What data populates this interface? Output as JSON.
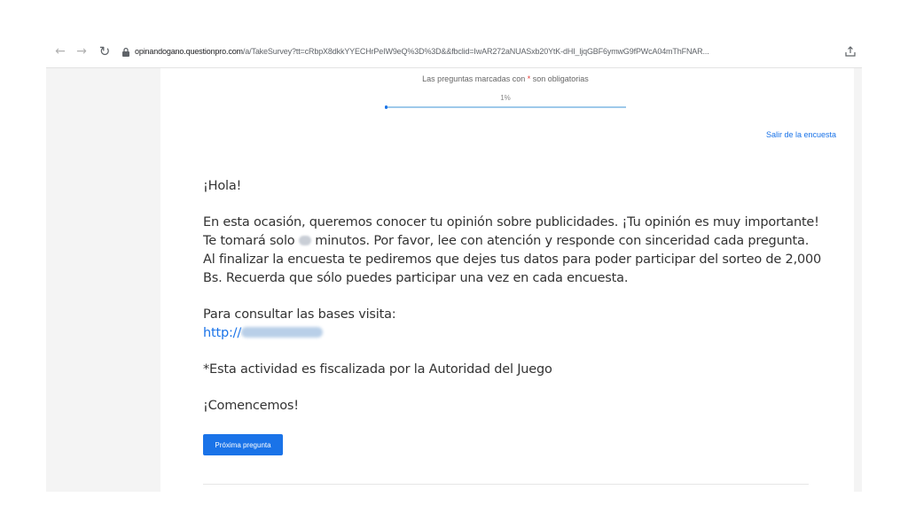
{
  "browser": {
    "url_host": "opinandogano.questionpro.com",
    "url_path": "/a/TakeSurvey?tt=cRbpX8dkkYYECHrPeIW9eQ%3D%3D&&fbclid=IwAR272aNUASxb20YtK-dHI_ljqGBF6ymwG9fPWcA04mThFNAR..."
  },
  "survey": {
    "exit_label": "Salir de la encuesta",
    "required_note_prefix": "Las preguntas marcadas con ",
    "required_star": "*",
    "required_note_suffix": " son obligatorias",
    "progress_label": "1%",
    "progress_value": 0.01
  },
  "content": {
    "greeting": "¡Hola!",
    "intro_line1": "En esta ocasión, queremos conocer tu opinión sobre publicidades. ¡Tu opinión es muy importante!",
    "intro_line2_before": "Te tomará solo ",
    "intro_line2_after": " minutos. Por favor, lee con atención y responde con sinceridad cada pregunta.",
    "intro_line3": "Al finalizar la encuesta te pediremos que dejes tus datos para poder participar del sorteo de 2,000",
    "intro_line4": "Bs. Recuerda que sólo puedes participar una vez en cada encuesta.",
    "bases_label": "Para consultar las bases visita:",
    "bases_link_prefix": "http://",
    "fiscal_note": "*Esta actividad es fiscalizada por la Autoridad del Juego",
    "start_label": "¡Comencemos!"
  },
  "actions": {
    "next_label": "Próxima pregunta"
  },
  "colors": {
    "accent": "#1a73e8",
    "required": "#e53935",
    "page_bg": "#f4f4f4"
  }
}
